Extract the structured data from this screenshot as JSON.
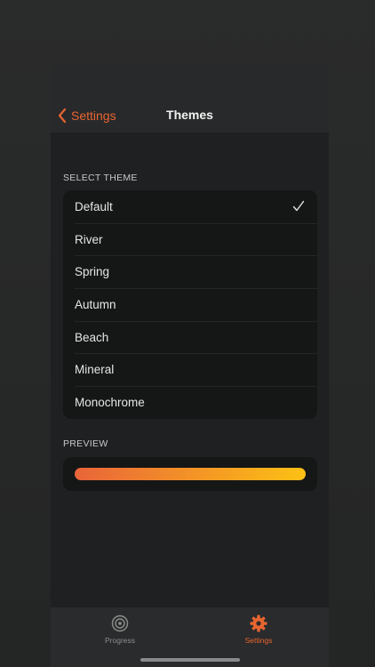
{
  "navbar": {
    "back_label": "Settings",
    "title": "Themes",
    "back_icon": "chevron-left-icon"
  },
  "select_theme": {
    "section_label": "SELECT THEME",
    "selected": "Default",
    "items": [
      {
        "label": "Default",
        "selected": true
      },
      {
        "label": "River",
        "selected": false
      },
      {
        "label": "Spring",
        "selected": false
      },
      {
        "label": "Autumn",
        "selected": false
      },
      {
        "label": "Beach",
        "selected": false
      },
      {
        "label": "Mineral",
        "selected": false
      },
      {
        "label": "Monochrome",
        "selected": false
      }
    ]
  },
  "preview": {
    "section_label": "PREVIEW",
    "gradient_start": "#e9643a",
    "gradient_end": "#fdc114"
  },
  "tabbar": {
    "tabs": [
      {
        "label": "Progress",
        "icon": "target-icon",
        "active": false
      },
      {
        "label": "Settings",
        "icon": "gear-icon",
        "active": true
      }
    ]
  },
  "colors": {
    "accent": "#e76530",
    "background": "#1f2021",
    "card": "#151616"
  }
}
